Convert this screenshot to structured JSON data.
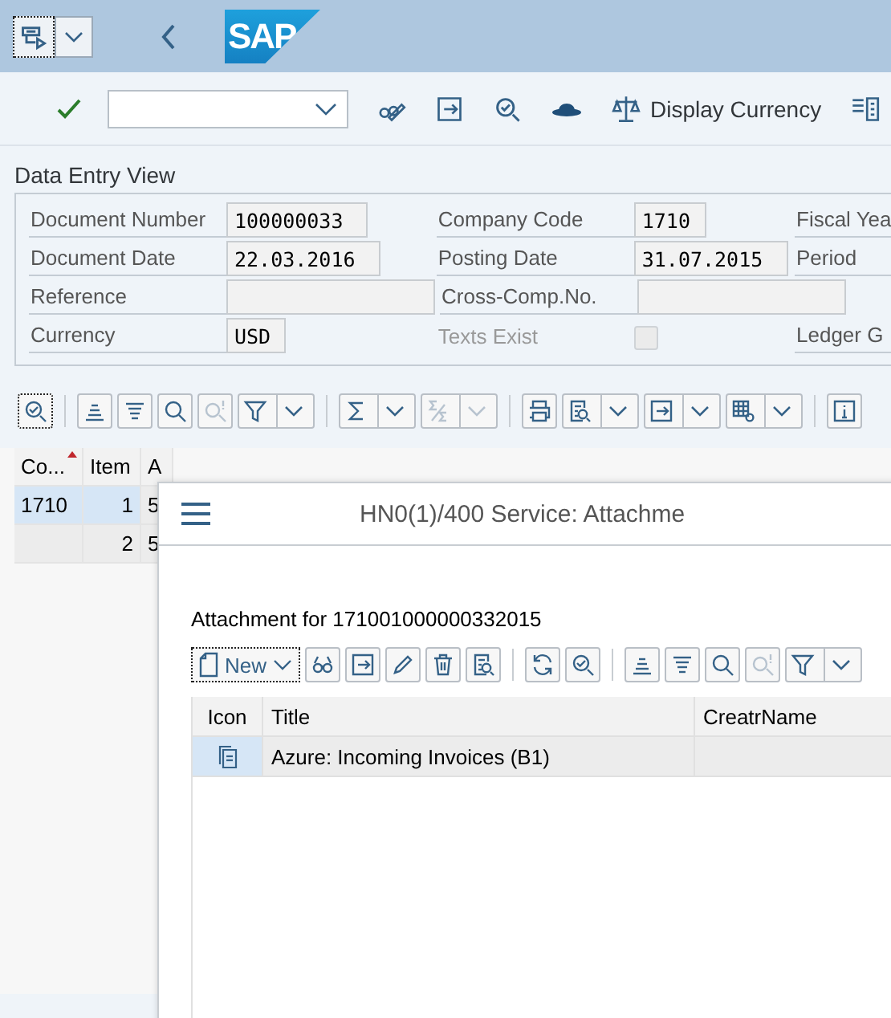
{
  "shell": {
    "logo": "SAP"
  },
  "toolbar": {
    "display_currency": "Display Currency"
  },
  "form": {
    "title": "Data Entry View",
    "rows": [
      [
        {
          "kind": "input",
          "label": "Document Number",
          "value": "100000033"
        },
        {
          "kind": "input",
          "label": "Company Code",
          "value": "1710"
        },
        {
          "kind": "label",
          "label": "Fiscal Yea"
        }
      ],
      [
        {
          "kind": "input",
          "label": "Document Date",
          "value": "22.03.2016"
        },
        {
          "kind": "input",
          "label": "Posting Date",
          "value": "31.07.2015"
        },
        {
          "kind": "label",
          "label": "Period"
        }
      ],
      [
        {
          "kind": "input",
          "label": "Reference"
        },
        {
          "kind": "input",
          "label": "Cross-Comp.No."
        }
      ],
      [
        {
          "kind": "input",
          "label": "Currency",
          "value": "USD"
        },
        {
          "kind": "checkbox",
          "label": "Texts Exist",
          "checked": false,
          "disabled": true
        },
        {
          "kind": "label",
          "label": "Ledger G"
        }
      ]
    ]
  },
  "grid_toolbar": [
    {
      "kind": "details",
      "dropdown": false,
      "disabled": false
    },
    {
      "kind": "sort_asc",
      "dropdown": false,
      "disabled": false
    },
    {
      "kind": "sort_desc",
      "dropdown": false,
      "disabled": false
    },
    {
      "kind": "find",
      "dropdown": false,
      "disabled": false
    },
    {
      "kind": "find_next",
      "dropdown": false,
      "disabled": true
    },
    {
      "kind": "filter",
      "dropdown": true,
      "disabled": false
    },
    {
      "kind": "sum",
      "dropdown": true,
      "disabled": false
    },
    {
      "kind": "subtotal",
      "dropdown": true,
      "disabled": true
    },
    {
      "kind": "print",
      "dropdown": false,
      "disabled": false
    },
    {
      "kind": "preview",
      "dropdown": true,
      "disabled": false
    },
    {
      "kind": "export",
      "dropdown": true,
      "disabled": false
    },
    {
      "kind": "layout",
      "dropdown": true,
      "disabled": false
    },
    {
      "kind": "info",
      "dropdown": false,
      "disabled": false
    }
  ],
  "grid": {
    "columns": [
      {
        "label": "Co...",
        "sorted": true
      },
      {
        "label": "Item",
        "sorted": false
      },
      {
        "label": "A",
        "sorted": false
      }
    ],
    "rows": [
      {
        "company_code": "1710",
        "item": "1",
        "column_3": "5",
        "selected": true
      },
      {
        "item": "2",
        "column_3": "5",
        "selected": false
      }
    ]
  },
  "dialog": {
    "title": "HN0(1)/400 Service: Attachme",
    "caption": "Attachment for 171001000000332015",
    "new_button": "New",
    "toolbar": [
      {
        "kind": "glasses",
        "dropdown": false,
        "disabled": false
      },
      {
        "kind": "export",
        "dropdown": false,
        "disabled": false
      },
      {
        "kind": "pencil",
        "dropdown": false,
        "disabled": false
      },
      {
        "kind": "trash",
        "dropdown": false,
        "disabled": false
      },
      {
        "kind": "preview",
        "dropdown": false,
        "disabled": false
      },
      {
        "kind": "refresh",
        "dropdown": false,
        "disabled": false
      },
      {
        "kind": "details",
        "dropdown": false,
        "disabled": false
      },
      {
        "kind": "sort_asc",
        "dropdown": false,
        "disabled": false
      },
      {
        "kind": "sort_desc",
        "dropdown": false,
        "disabled": false
      },
      {
        "kind": "find",
        "dropdown": false,
        "disabled": false
      },
      {
        "kind": "find_next",
        "dropdown": false,
        "disabled": true
      },
      {
        "kind": "filter",
        "dropdown": true,
        "disabled": false
      }
    ],
    "table": {
      "columns": [
        "Icon",
        "Title",
        "CreatrName"
      ],
      "rows": [
        {
          "title": "Azure: Incoming Invoices (B1)",
          "selected": true
        }
      ]
    }
  }
}
